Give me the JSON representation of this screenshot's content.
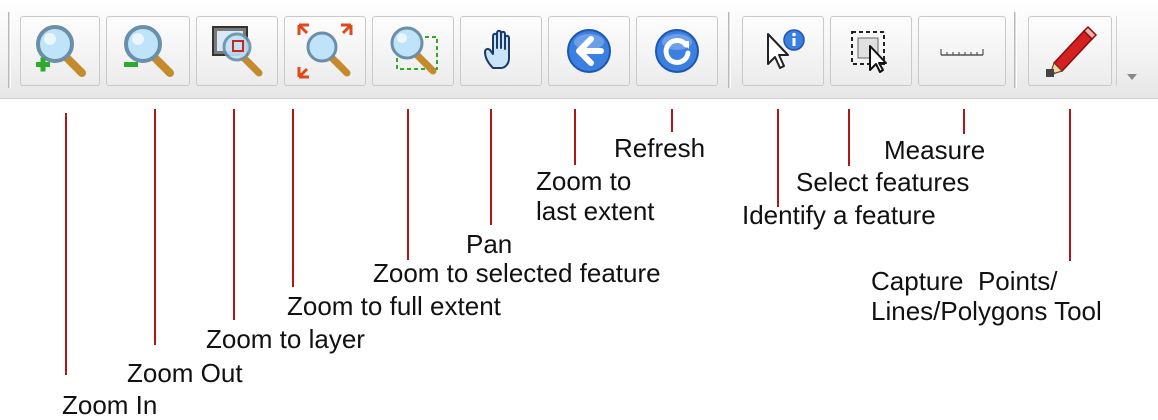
{
  "toolbar": {
    "tools": [
      {
        "id": "zoom-in",
        "icon": "magnifier-plus-icon",
        "label": "Zoom In"
      },
      {
        "id": "zoom-out",
        "icon": "magnifier-minus-icon",
        "label": "Zoom Out"
      },
      {
        "id": "zoom-layer",
        "icon": "zoom-to-layer-icon",
        "label": "Zoom to layer"
      },
      {
        "id": "zoom-full",
        "icon": "zoom-full-extent-icon",
        "label": "Zoom to full extent"
      },
      {
        "id": "zoom-selected",
        "icon": "zoom-selected-icon",
        "label": "Zoom to selected feature"
      },
      {
        "id": "pan",
        "icon": "hand-icon",
        "label": "Pan"
      },
      {
        "id": "zoom-last",
        "icon": "back-arrow-icon",
        "label_lines": [
          "Zoom to",
          "last extent"
        ]
      },
      {
        "id": "refresh",
        "icon": "refresh-icon",
        "label": "Refresh"
      },
      {
        "id": "identify",
        "icon": "pointer-info-icon",
        "label": "Identify a feature"
      },
      {
        "id": "select",
        "icon": "select-box-icon",
        "label": "Select features"
      },
      {
        "id": "measure",
        "icon": "ruler-icon",
        "label": "Measure"
      },
      {
        "id": "capture",
        "icon": "pencil-icon",
        "label_lines": [
          "Capture  Points/",
          "Lines/Polygons Tool"
        ]
      }
    ],
    "overflow_icon": "dropdown-arrow-icon"
  },
  "colors": {
    "leader_line": "#b01818",
    "icon_blue": "#3b7fe0",
    "lens_blue": "#9fd0f0"
  }
}
